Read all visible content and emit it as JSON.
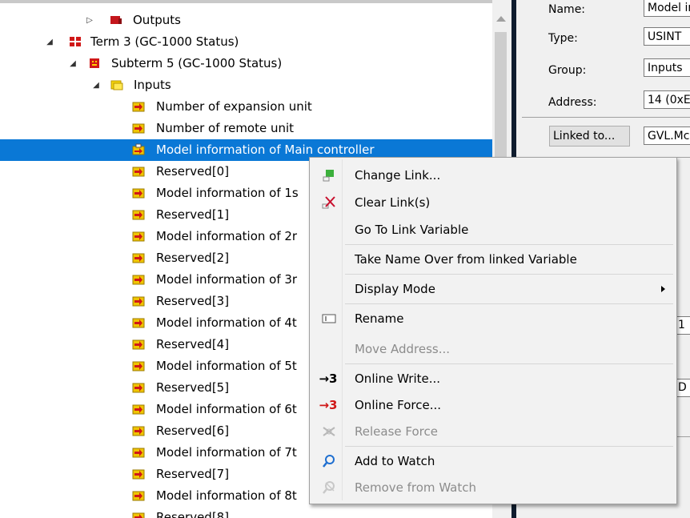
{
  "tree": {
    "nodes": [
      {
        "label": "Outputs",
        "expander": "▷",
        "icon": "outputs-icon"
      },
      {
        "label": "Term 3 (GC-1000 Status)",
        "expander": "◢",
        "icon": "terminal-icon"
      },
      {
        "label": "Subterm 5 (GC-1000 Status)",
        "expander": "◢",
        "icon": "subterminal-icon"
      },
      {
        "label": "Inputs",
        "expander": "◢",
        "icon": "inputs-folder-icon"
      },
      {
        "label": "Number of expansion unit",
        "icon": "input-variable-icon"
      },
      {
        "label": "Number of remote unit",
        "icon": "input-variable-icon"
      },
      {
        "label": "Model information of Main controller",
        "icon": "linked-variable-icon",
        "selected": true
      },
      {
        "label": "Reserved[0]",
        "icon": "input-variable-icon"
      },
      {
        "label": "Model information of 1s",
        "icon": "input-variable-icon"
      },
      {
        "label": "Reserved[1]",
        "icon": "input-variable-icon"
      },
      {
        "label": "Model information of 2r",
        "icon": "input-variable-icon"
      },
      {
        "label": "Reserved[2]",
        "icon": "input-variable-icon"
      },
      {
        "label": "Model information of 3r",
        "icon": "input-variable-icon"
      },
      {
        "label": "Reserved[3]",
        "icon": "input-variable-icon"
      },
      {
        "label": "Model information of 4t",
        "icon": "input-variable-icon"
      },
      {
        "label": "Reserved[4]",
        "icon": "input-variable-icon"
      },
      {
        "label": "Model information of 5t",
        "icon": "input-variable-icon"
      },
      {
        "label": "Reserved[5]",
        "icon": "input-variable-icon"
      },
      {
        "label": "Model information of 6t",
        "icon": "input-variable-icon"
      },
      {
        "label": "Reserved[6]",
        "icon": "input-variable-icon"
      },
      {
        "label": "Model information of 7t",
        "icon": "input-variable-icon"
      },
      {
        "label": "Reserved[7]",
        "icon": "input-variable-icon"
      },
      {
        "label": "Model information of 8t",
        "icon": "input-variable-icon"
      },
      {
        "label": "Reserved[8]",
        "icon": "input-variable-icon"
      }
    ]
  },
  "properties": {
    "name_label": "Name:",
    "name_value": "Model ir",
    "type_label": "Type:",
    "type_value": "USINT",
    "group_label": "Group:",
    "group_value": "Inputs",
    "address_label": "Address:",
    "address_value": "14 (0xE",
    "linked_button": "Linked to...",
    "linked_value": "GVL.Mc",
    "partial_1": "1",
    "partial_2": "D"
  },
  "context_menu": {
    "items": [
      {
        "label": "Change Link...",
        "icon": "change-link-icon",
        "enabled": true
      },
      {
        "label": "Clear Link(s)",
        "icon": "clear-link-icon",
        "enabled": true
      },
      {
        "label": "Go To Link Variable",
        "icon": "",
        "enabled": true
      },
      {
        "label": "Take Name Over from linked Variable",
        "icon": "",
        "enabled": true
      },
      {
        "label": "Display Mode",
        "icon": "",
        "enabled": true,
        "submenu": true
      },
      {
        "label": "Rename",
        "icon": "rename-icon",
        "enabled": true
      },
      {
        "label": "Move Address...",
        "icon": "",
        "enabled": false
      },
      {
        "label": "Online Write...",
        "icon": "online-write-icon",
        "glyph": "→3",
        "enabled": true
      },
      {
        "label": "Online Force...",
        "icon": "online-force-icon",
        "glyph": "→3",
        "enabled": true
      },
      {
        "label": "Release Force",
        "icon": "release-force-icon",
        "enabled": false
      },
      {
        "label": "Add to Watch",
        "icon": "add-watch-icon",
        "enabled": true
      },
      {
        "label": "Remove from Watch",
        "icon": "remove-watch-icon",
        "enabled": false
      }
    ]
  },
  "colors": {
    "selection": "#0a78d6",
    "input_icon": "#e8b400",
    "terminal_red": "#d01818"
  }
}
